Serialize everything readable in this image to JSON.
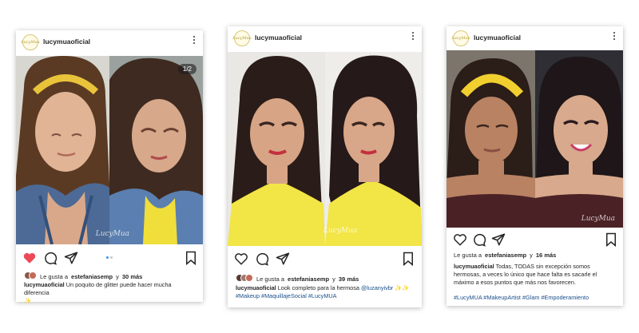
{
  "posts": [
    {
      "avatar_text": "LucyMua",
      "username": "lucymuaoficial",
      "slide_badge": "1/2",
      "watermark": "LucyMua",
      "liked": true,
      "likes_prefix": "Le gusta a",
      "likes_user": "estefaniasemp",
      "likes_y": "y",
      "likes_count": "30 más",
      "caption_user": "lucymuaoficial",
      "caption_text": "Un poquito de glitter puede hacer mucha diferencia",
      "caption_emoji": "✨",
      "caption_tags": ""
    },
    {
      "avatar_text": "LucyMua",
      "username": "lucymuaoficial",
      "watermark": "LucyMua",
      "liked": false,
      "likes_prefix": "Le gusta a",
      "likes_user": "estefaniasemp",
      "likes_y": "y",
      "likes_count": "39 más",
      "caption_user": "lucymuaoficial",
      "caption_text": "Look completo para la hermosa",
      "caption_mention": "@luzanyivbr",
      "caption_emoji": "✨✨",
      "caption_tags": "#Makeup #MaquillajeSocial #LucyMUA"
    },
    {
      "avatar_text": "LucyMua",
      "username": "lucymuaoficial",
      "watermark": "LucyMua",
      "liked": false,
      "likes_prefix": "Le gusta a",
      "likes_user": "estefaniasemp",
      "likes_y": "y",
      "likes_count": "16 más",
      "caption_user": "lucymuaoficial",
      "caption_text": "Todas, TODAS sin excepción somos hermosas, a veces lo único que hace falta es sacarle el máximo a esos puntos que más nos favorecen.",
      "caption_tags": "#LucyMUA #MakeupArtist #Glam #Empoderamiento"
    }
  ],
  "colors": {
    "heart": "#ed4956",
    "link": "#1a4f8a",
    "dot_active": "#3897f0"
  },
  "icons": [
    "heart-icon",
    "comment-icon",
    "share-icon",
    "bookmark-icon",
    "more-options-icon"
  ]
}
